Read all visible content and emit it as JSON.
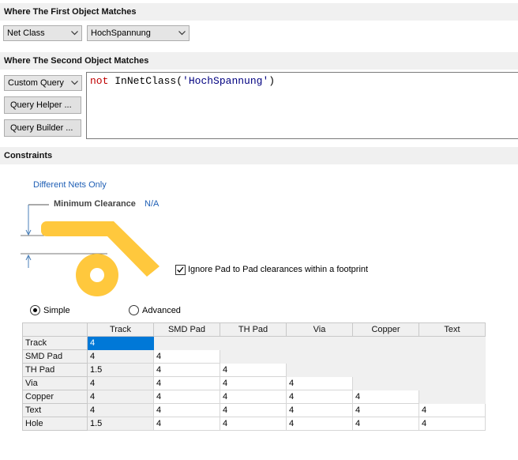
{
  "first_object": {
    "header": "Where The First Object Matches",
    "type_combo": "Net Class",
    "value_combo": "HochSpannung"
  },
  "second_object": {
    "header": "Where The Second Object Matches",
    "type_combo": "Custom Query",
    "query_helper_btn": "Query Helper ...",
    "query_builder_btn": "Query Builder ...",
    "query": {
      "keyword": "not",
      "function": "InNetClass(",
      "string": "'HochSpannung'",
      "close": ")"
    }
  },
  "constraints": {
    "header": "Constraints",
    "different_nets_link": "Different Nets Only",
    "min_clearance_label": "Minimum Clearance",
    "min_clearance_value": "N/A",
    "ignore_pad_checkbox_label": "Ignore Pad to Pad clearances within a footprint",
    "ignore_pad_checked": true,
    "mode_simple": "Simple",
    "mode_advanced": "Advanced",
    "mode_selected": "Simple",
    "graphic_color": "#ffc83d",
    "grid": {
      "columns": [
        "Track",
        "SMD Pad",
        "TH Pad",
        "Via",
        "Copper",
        "Text"
      ],
      "rows": [
        {
          "label": "Track",
          "values": [
            "4",
            "",
            "",
            "",
            "",
            ""
          ]
        },
        {
          "label": "SMD Pad",
          "values": [
            "4",
            "4",
            "",
            "",
            "",
            ""
          ]
        },
        {
          "label": "TH Pad",
          "values": [
            "1.5",
            "4",
            "4",
            "",
            "",
            ""
          ]
        },
        {
          "label": "Via",
          "values": [
            "4",
            "4",
            "4",
            "4",
            "",
            ""
          ]
        },
        {
          "label": "Copper",
          "values": [
            "4",
            "4",
            "4",
            "4",
            "4",
            ""
          ]
        },
        {
          "label": "Text",
          "values": [
            "4",
            "4",
            "4",
            "4",
            "4",
            "4"
          ]
        },
        {
          "label": "Hole",
          "values": [
            "1.5",
            "4",
            "4",
            "4",
            "4",
            "4"
          ]
        }
      ]
    }
  }
}
